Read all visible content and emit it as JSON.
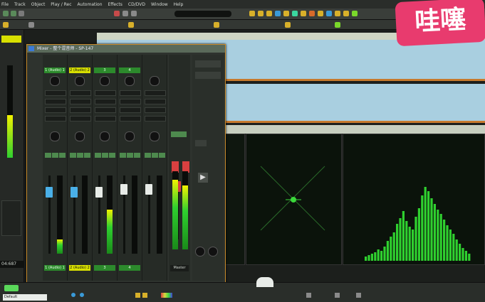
{
  "menu": [
    "File",
    "Track",
    "Object",
    "Play / Rec",
    "Automation",
    "Effects",
    "CD/DVD",
    "Window",
    "Help"
  ],
  "mixer": {
    "title": "Mixer - 整个混音师 - SP-147",
    "channels": [
      {
        "name": "1 (Audio) 1",
        "color": "#2c8a2c"
      },
      {
        "name": "2 (Audio) 2",
        "color": "#d8e000"
      },
      {
        "name": "3",
        "color": "#2c8a2c"
      },
      {
        "name": "4",
        "color": "#2c8a2c"
      }
    ],
    "master_label": "Master",
    "bottom_names": [
      "1 (Audio) 1",
      "2 (Audio) 2",
      "3",
      "4"
    ]
  },
  "transport": {
    "time": "04:687"
  },
  "preset": {
    "label": "Default"
  },
  "sticker": {
    "text": "哇噻"
  },
  "colors": {
    "accent": "#c77a2d",
    "meter_green": "#2fd02f",
    "lane": "#a9cfe0"
  }
}
